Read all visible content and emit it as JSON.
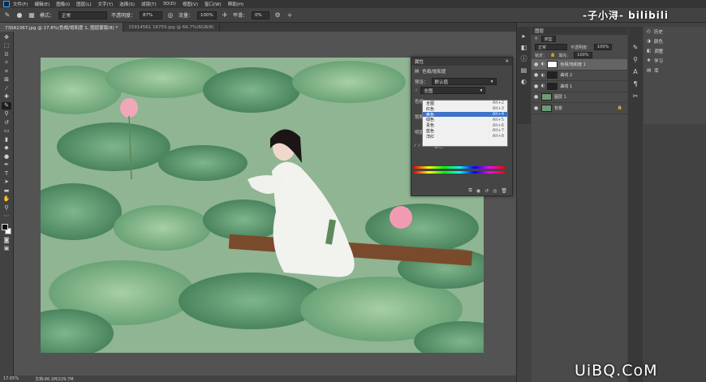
{
  "menubar": {
    "items": [
      "文件(F)",
      "编辑(E)",
      "图像(I)",
      "图层(L)",
      "文字(Y)",
      "选择(S)",
      "滤镜(T)",
      "3D(D)",
      "视图(V)",
      "窗口(W)",
      "帮助(H)"
    ]
  },
  "options": {
    "mode_label": "模式：",
    "mode_value": "正常",
    "opacity_label": "不透明度：",
    "opacity_value": "87%",
    "flow_label": "流量：",
    "flow_value": "100%",
    "smooth_label": "平滑：",
    "smooth_value": "0%"
  },
  "tabs": [
    {
      "label": "730A1367.jpg @ 17.8%(色相/饱和度 1, 图层蒙版/8) *"
    },
    {
      "label": "15914561 16755.jpg @ 66.7%(RGB/8)"
    }
  ],
  "status": {
    "zoom": "17.65%",
    "doc": "文档:86.1M/229.7M"
  },
  "properties": {
    "title": "属性",
    "adj_name": "色相/饱和度",
    "preset_label": "预设：",
    "preset_value": "默认值",
    "channel_value": "全图",
    "row_labels": [
      "色相",
      "饱和度",
      "明度"
    ],
    "colorize_label": "着色",
    "dropdown": [
      {
        "label": "全图",
        "shortcut": "Alt+2"
      },
      {
        "label": "红色",
        "shortcut": "Alt+3"
      },
      {
        "label": "黄色",
        "shortcut": "Alt+4"
      },
      {
        "label": "绿色",
        "shortcut": "Alt+5"
      },
      {
        "label": "青色",
        "shortcut": "Alt+6"
      },
      {
        "label": "蓝色",
        "shortcut": "Alt+7"
      },
      {
        "label": "洋红",
        "shortcut": "Alt+8"
      }
    ]
  },
  "layers_panel": {
    "tab": "图层",
    "kind_label": "类型",
    "blend_value": "正常",
    "opacity_label": "不透明度：",
    "opacity_value": "100%",
    "fill_label": "填充：",
    "fill_value": "100%",
    "lock_label": "锁定：",
    "layers": [
      {
        "name": "色相/饱和度 1",
        "active": true
      },
      {
        "name": "曲线 2",
        "active": false
      },
      {
        "name": "曲线 1",
        "active": false
      },
      {
        "name": "图层 1",
        "active": false
      },
      {
        "name": "背景",
        "active": false
      }
    ]
  },
  "right_col": {
    "items": [
      "历史",
      "颜色",
      "调整",
      "学习",
      "库"
    ]
  },
  "watermarks": {
    "channel": "-子小浔- bilibili",
    "site": "UiBQ.CoM"
  }
}
